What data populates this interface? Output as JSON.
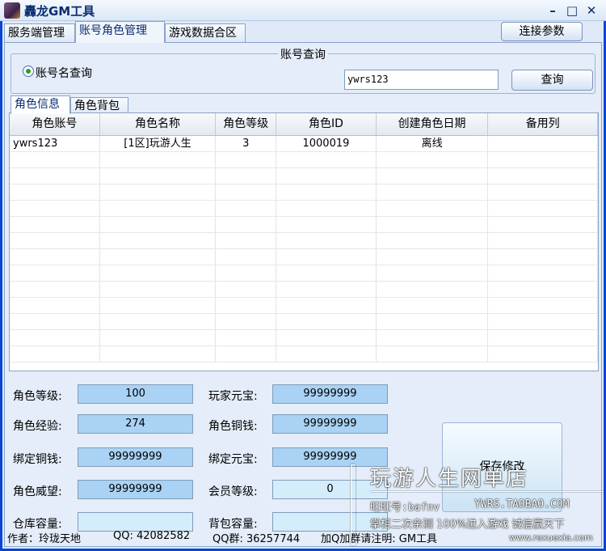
{
  "window": {
    "title": "轟龙GM工具",
    "min": "–",
    "max": "□",
    "close": "✕"
  },
  "tabs": [
    "服务端管理",
    "账号角色管理",
    "游戏数据合区"
  ],
  "connect_button": "连接参数",
  "account_query": {
    "group_title": "账号查询",
    "radio_label": "账号名查询",
    "input_value": "ywrs123",
    "query_button": "查询"
  },
  "subtabs": [
    "角色信息",
    "角色背包"
  ],
  "table": {
    "columns": [
      "角色账号",
      "角色名称",
      "角色等级",
      "角色ID",
      "创建角色日期",
      "备用列"
    ],
    "rows": [
      [
        "ywrs123",
        "[1区]玩游人生",
        "3",
        "1000019",
        "离线",
        ""
      ]
    ]
  },
  "fields": {
    "level_label": "角色等级:",
    "level_value": "100",
    "exp_label": "角色经验:",
    "exp_value": "274",
    "bound_copper_label": "绑定铜钱:",
    "bound_copper_value": "99999999",
    "prestige_label": "角色威望:",
    "prestige_value": "99999999",
    "warehouse_label": "仓库容量:",
    "warehouse_value": "",
    "ingot_label": "玩家元宝:",
    "ingot_value": "99999999",
    "copper_label": "角色铜钱:",
    "copper_value": "99999999",
    "bound_ingot_label": "绑定元宝:",
    "bound_ingot_value": "99999999",
    "vip_label": "会员等级:",
    "vip_value": "0",
    "bag_label": "背包容量:",
    "bag_value": ""
  },
  "save_button": "保存修改",
  "status": {
    "author": "作者：玲珑天地",
    "qq": "QQ: 42082582",
    "qq_group": "QQ群: 36257744",
    "note": "加Q加群请注明: GM工具"
  },
  "watermark": {
    "shop": "玩游人生网单店",
    "wangwang": "旺旺号:bafnv",
    "taobao": "YWRS.TAOBAO.COM",
    "line3": "掌柜二次亲测  100%进入游戏  诚信赢天下",
    "site": "www.rexuexia.com"
  }
}
